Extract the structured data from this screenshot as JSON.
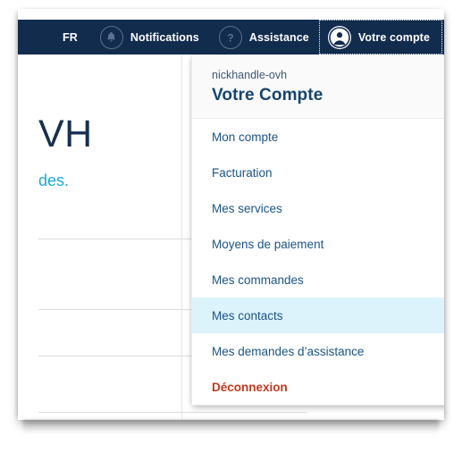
{
  "navbar": {
    "background_color": "#122c4e",
    "items": [
      {
        "name": "language",
        "label": "FR",
        "icon": null
      },
      {
        "name": "notifications",
        "label": "Notifications",
        "icon": "bell-icon"
      },
      {
        "name": "assistance",
        "label": "Assistance",
        "icon": "question-mark-icon"
      },
      {
        "name": "account",
        "label": "Votre compte",
        "icon": "user-avatar-icon",
        "focused": true
      }
    ]
  },
  "page_content": {
    "heading": "VH",
    "subtext": "des",
    "subtext_punctuation": ".",
    "heading_color": "#16314f",
    "subtext_color": "#1ca8d4"
  },
  "dropdown": {
    "nickhandle": "nickhandle-ovh",
    "title": "Votre Compte",
    "header_background": "#fafafa",
    "highlight_color": "#ddf3fb",
    "link_color": "#1a5386",
    "logout_color": "#c4391d",
    "items": [
      {
        "label": "Mon compte",
        "active": false,
        "logout": false
      },
      {
        "label": "Facturation",
        "active": false,
        "logout": false
      },
      {
        "label": "Mes services",
        "active": false,
        "logout": false
      },
      {
        "label": "Moyens de paiement",
        "active": false,
        "logout": false
      },
      {
        "label": "Mes commandes",
        "active": false,
        "logout": false
      },
      {
        "label": "Mes contacts",
        "active": true,
        "logout": false
      },
      {
        "label": "Mes demandes d’assistance",
        "active": false,
        "logout": false
      },
      {
        "label": "Déconnexion",
        "active": false,
        "logout": true
      }
    ]
  }
}
